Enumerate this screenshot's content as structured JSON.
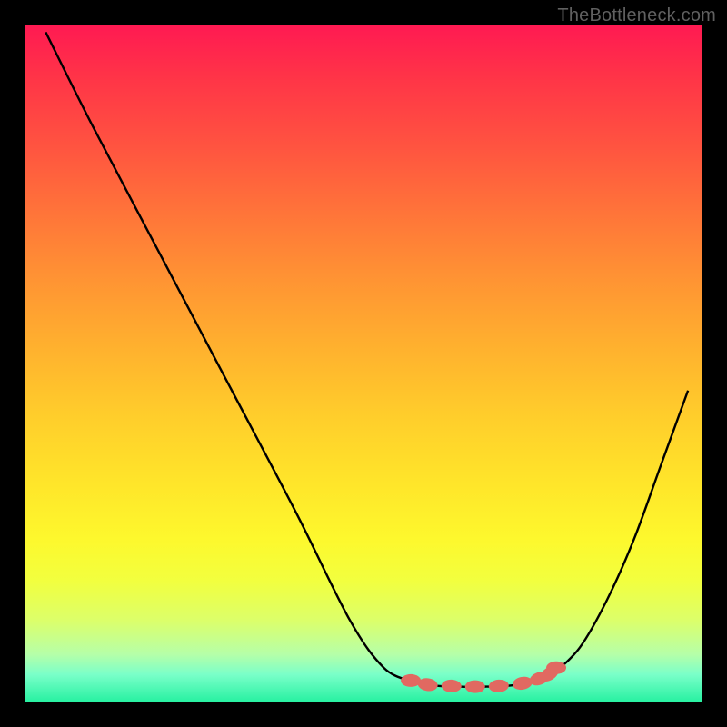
{
  "watermark": "TheBottleneck.com",
  "colors": {
    "background": "#000000",
    "curve_stroke": "#000000",
    "marker_fill": "#e16961",
    "gradient_top": "#ff1a52",
    "gradient_bottom": "#28f1a2"
  },
  "chart_data": {
    "type": "line",
    "title": "",
    "xlabel": "",
    "ylabel": "",
    "xlim": [
      0,
      100
    ],
    "ylim": [
      0,
      100
    ],
    "note": "Axes are unlabeled; values are geometric estimates (0-100 normalized to plot area). y=0 at bottom, y=100 at top.",
    "series": [
      {
        "name": "left-branch",
        "x": [
          3,
          10,
          20,
          30,
          40,
          48,
          53,
          57
        ],
        "y": [
          99,
          85,
          66,
          47,
          28,
          12,
          5,
          3
        ]
      },
      {
        "name": "valley-floor",
        "x": [
          57,
          60,
          64,
          68,
          72,
          75,
          78
        ],
        "y": [
          3,
          2.4,
          2.2,
          2.2,
          2.4,
          3,
          4
        ]
      },
      {
        "name": "right-branch",
        "x": [
          78,
          82,
          86,
          90,
          94,
          98
        ],
        "y": [
          4,
          8,
          15,
          24,
          35,
          46
        ]
      }
    ],
    "markers": {
      "name": "highlight-dots",
      "x": [
        57,
        59.5,
        63,
        66.5,
        70,
        73.5,
        76,
        77.5,
        78.5
      ],
      "y": [
        3.1,
        2.5,
        2.3,
        2.2,
        2.3,
        2.7,
        3.4,
        4.1,
        5.0
      ]
    }
  }
}
